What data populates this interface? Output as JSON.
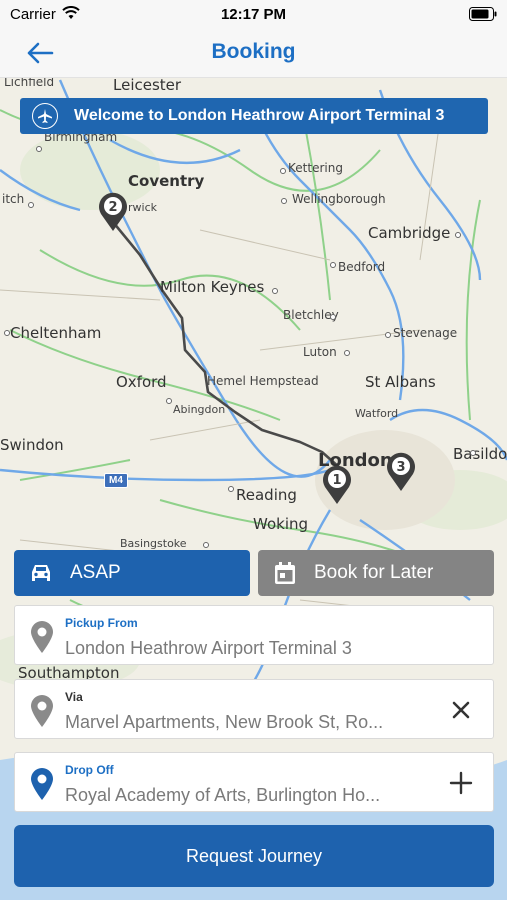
{
  "status": {
    "carrier": "Carrier",
    "time": "12:17 PM"
  },
  "nav": {
    "title": "Booking"
  },
  "banner": {
    "text": "Welcome to London Heathrow Airport Terminal 3"
  },
  "map": {
    "labels": {
      "leicester": "Leicester",
      "birmingham": "Birmingham",
      "lichfield": "Lichfield",
      "itch": "itch",
      "coventry": "Coventry",
      "warwick": "rwick",
      "kettering": "Kettering",
      "wellingborough": "Wellingborough",
      "cambridge": "Cambridge",
      "bedford": "Bedford",
      "milton_keynes": "Milton Keynes",
      "bletchley": "Bletchley",
      "stevenage": "Stevenage",
      "cheltenham": "Cheltenham",
      "luton": "Luton",
      "oxford": "Oxford",
      "hemel": "Hemel Hempstead",
      "st_albans": "St Albans",
      "abingdon": "Abingdon",
      "watford": "Watford",
      "swindon": "Swindon",
      "london": "London",
      "basildon": "Basildo",
      "reading": "Reading",
      "woking": "Woking",
      "basingstoke": "Basingstoke",
      "southampton": "Southampton",
      "m4": "M4"
    },
    "pins": [
      "1",
      "2",
      "3"
    ]
  },
  "modes": {
    "asap": "ASAP",
    "later": "Book for Later"
  },
  "fields": {
    "pickup": {
      "caption": "Pickup From",
      "value": "London Heathrow Airport Terminal 3"
    },
    "via": {
      "caption": "Via",
      "value": "Marvel Apartments, New Brook St, Ro..."
    },
    "dropoff": {
      "caption": "Drop Off",
      "value": "Royal Academy of Arts, Burlington Ho..."
    }
  },
  "request": {
    "label": "Request Journey"
  },
  "colors": {
    "accent": "#1e62ae",
    "title": "#1d6fc4",
    "secondary": "#848484",
    "caption_blue": "#1d6fc4",
    "pin_grey": "#8a8a8a"
  }
}
